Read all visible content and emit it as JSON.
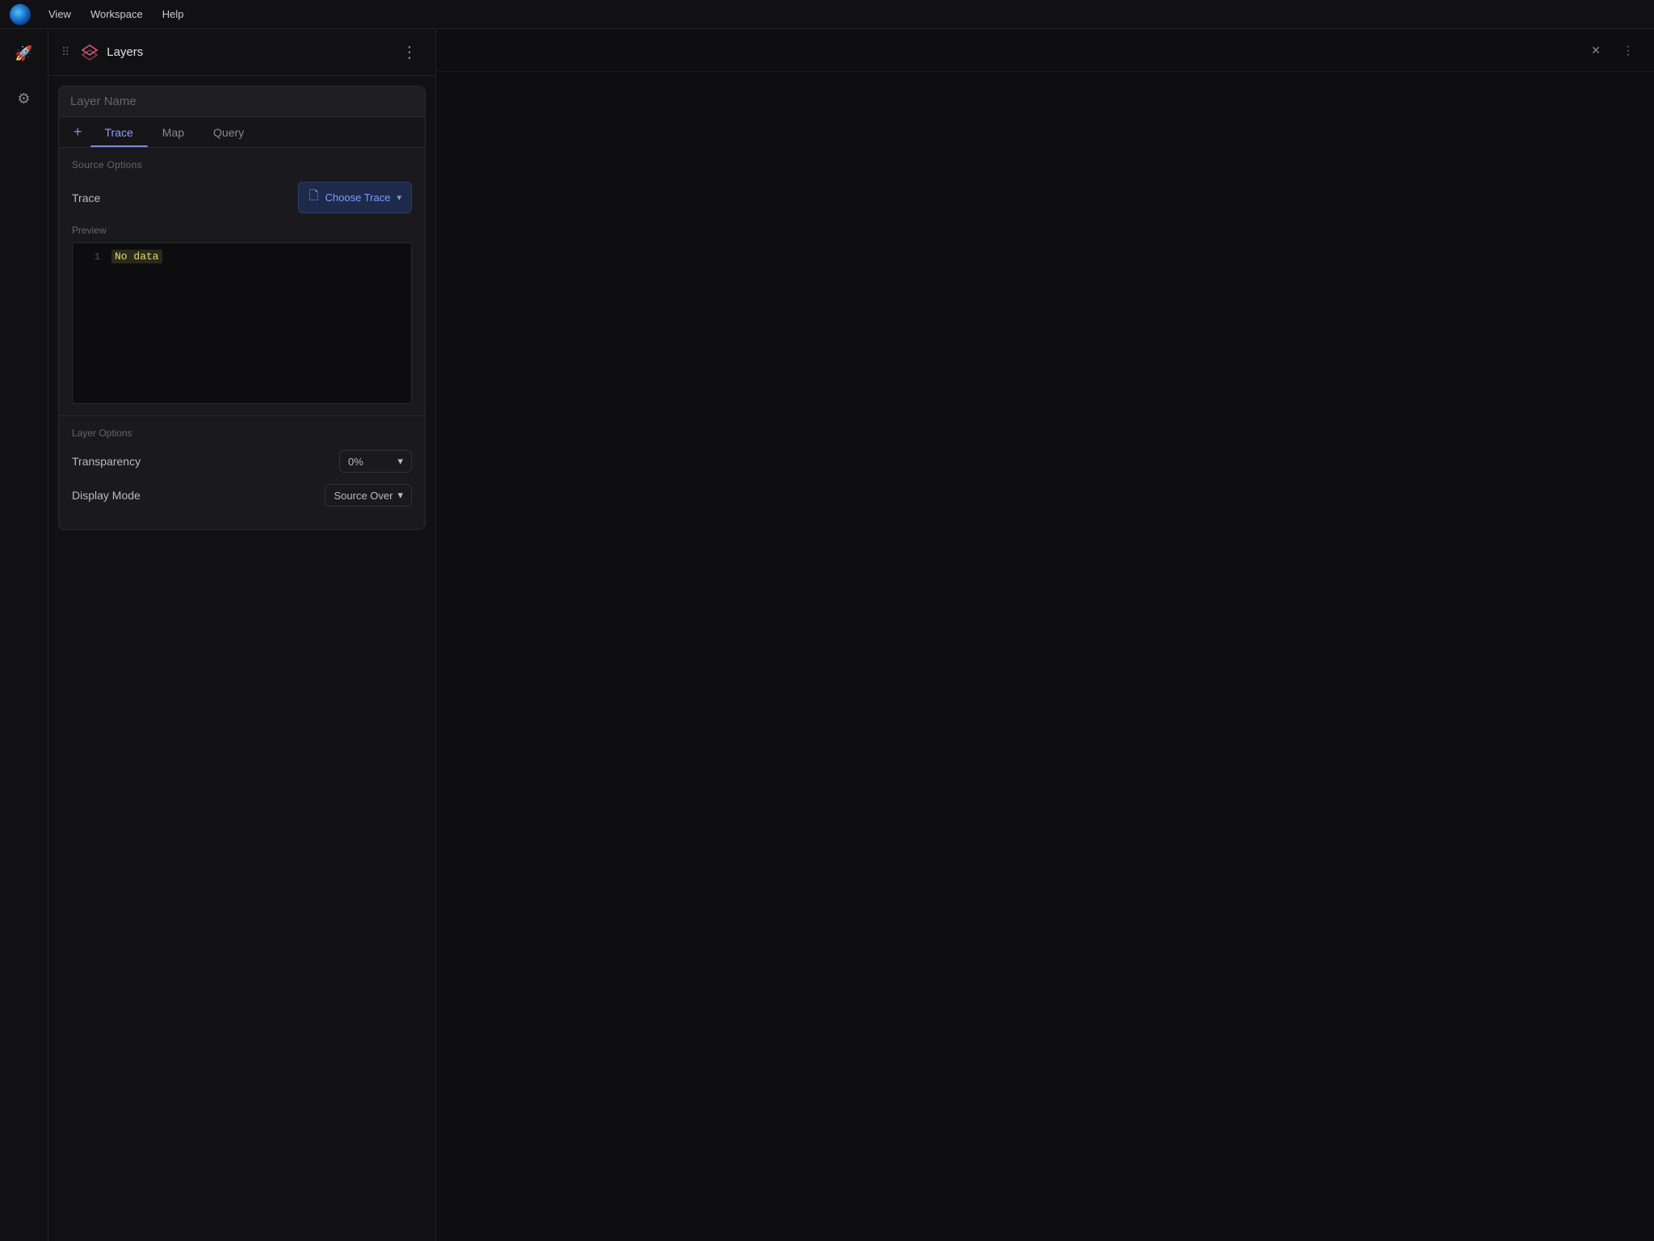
{
  "menubar": {
    "items": [
      "View",
      "Workspace",
      "Help"
    ]
  },
  "panel": {
    "title": "Layers",
    "drag_handle": "⠿"
  },
  "layer_card": {
    "name_placeholder": "Layer Name",
    "tabs": [
      {
        "id": "trace",
        "label": "Trace",
        "active": true
      },
      {
        "id": "map",
        "label": "Map",
        "active": false
      },
      {
        "id": "query",
        "label": "Query",
        "active": false
      }
    ],
    "source_options": {
      "section_label": "Source Options",
      "trace_label": "Trace",
      "choose_trace_label": "Choose Trace",
      "preview_label": "Preview",
      "preview_line_number": "1",
      "preview_content": "No data"
    },
    "layer_options": {
      "section_label": "Layer Options",
      "transparency_label": "Transparency",
      "transparency_value": "0%",
      "display_mode_label": "Display Mode",
      "display_mode_value": "Source Over"
    }
  },
  "icons": {
    "rocket": "🚀",
    "gear": "⚙",
    "dots_grid": "⠿",
    "plus": "+",
    "close": "✕",
    "chevron_down": "▾",
    "more_vert": "⋮",
    "file_trace": "🗋"
  }
}
